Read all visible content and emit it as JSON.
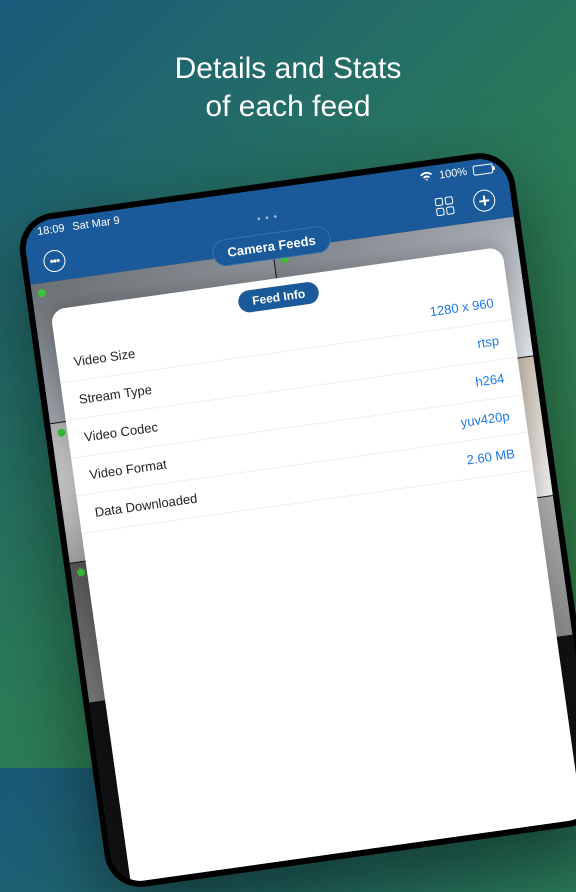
{
  "marketing": {
    "title_line1": "Details and Stats",
    "title_line2": "of each feed"
  },
  "status": {
    "time": "18:09",
    "date": "Sat Mar 9",
    "battery_pct": "100%"
  },
  "header": {
    "title": "Camera Feeds"
  },
  "modal": {
    "title": "Feed Info",
    "rows": [
      {
        "label": "Video Size",
        "value": "1280 x 960"
      },
      {
        "label": "Stream Type",
        "value": "rtsp"
      },
      {
        "label": "Video Codec",
        "value": "h264"
      },
      {
        "label": "Video Format",
        "value": "yuv420p"
      },
      {
        "label": "Data Downloaded",
        "value": "2.60 MB"
      }
    ]
  }
}
